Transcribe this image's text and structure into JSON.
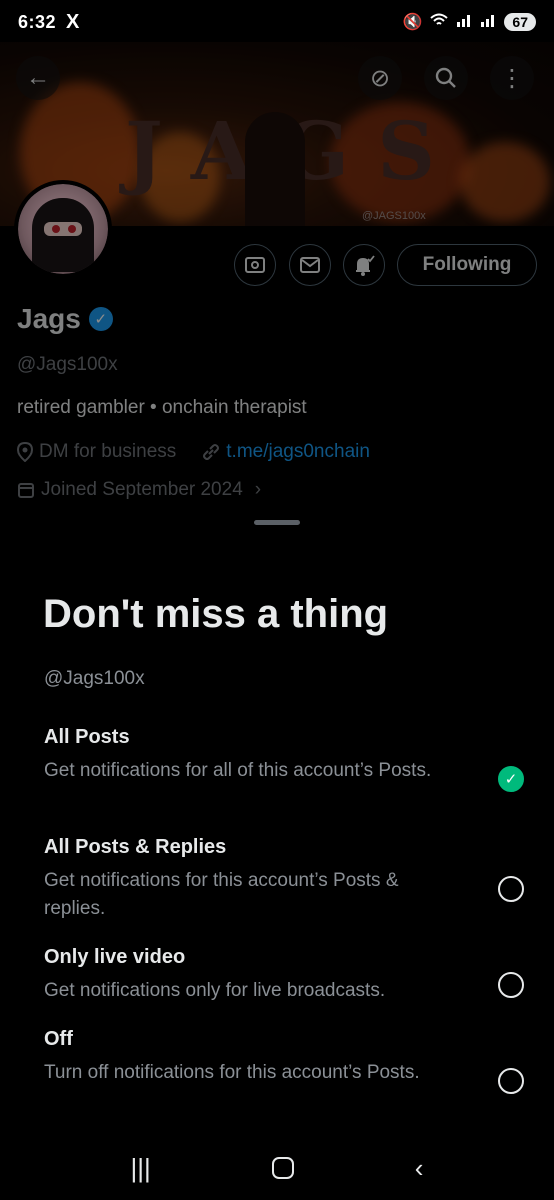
{
  "status_bar": {
    "time": "6:32",
    "app_icon": "X",
    "battery": "67"
  },
  "banner": {
    "title": "JAGS",
    "handle": "@JAGS100x"
  },
  "profile": {
    "name": "Jags",
    "handle": "@Jags100x",
    "bio": "retired gambler • onchain therapist",
    "location": "DM for business",
    "link": "t.me/jags0nchain",
    "joined": "Joined September 2024",
    "following_label": "Following"
  },
  "sheet": {
    "title": "Don't miss a thing",
    "handle": "@Jags100x",
    "options": [
      {
        "title": "All Posts",
        "description": "Get notifications for all of this account’s Posts.",
        "selected": true
      },
      {
        "title": "All Posts & Replies",
        "description": "Get notifications for this account’s Posts & replies.",
        "selected": false
      },
      {
        "title": "Only live video",
        "description": "Get notifications only for live broadcasts.",
        "selected": false
      },
      {
        "title": "Off",
        "description": "Turn off notifications for this account’s Posts.",
        "selected": false
      }
    ]
  },
  "icons": {
    "check": "✓",
    "back": "←",
    "search": "⌕",
    "more": "⋮",
    "grok": "⊘",
    "chevron": "›",
    "nav_recent": "|||",
    "nav_back": "‹"
  },
  "colors": {
    "accent": "#1d9bf0",
    "selected": "#00ba7c"
  }
}
